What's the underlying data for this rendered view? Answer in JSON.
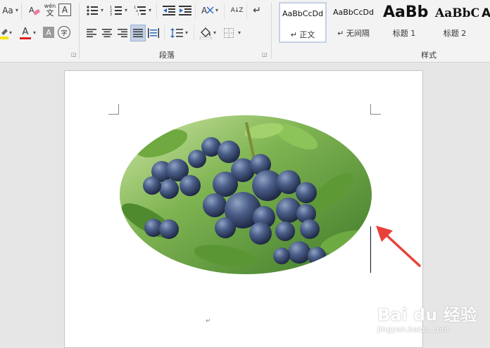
{
  "ribbon": {
    "font_group": {
      "change_case_label": "Aa",
      "phonetic_guide_top": "wén",
      "phonetic_guide_bottom": "文",
      "char_border_label": "A",
      "font_color_label": "A",
      "char_shading_label": "A",
      "enclose_char_label": "字",
      "font_color_bar": "#e02020",
      "highlight_bar": "#f5e500"
    },
    "paragraph_group": {
      "label": "段落",
      "sort_label": "A↓Z",
      "show_marks_label": "↵"
    },
    "styles_group": {
      "label": "样式",
      "items": [
        {
          "sample": "AaBbCcDd",
          "name": "↵ 正文",
          "selected": true
        },
        {
          "sample": "AaBbCcDd",
          "name": "↵ 无间隔",
          "selected": false
        },
        {
          "sample": "AaBb",
          "name": "标题 1",
          "selected": false
        },
        {
          "sample": "AaBbC",
          "name": "标题 2",
          "selected": false
        },
        {
          "sample": "A",
          "name": "",
          "selected": false
        }
      ]
    }
  },
  "document": {
    "paragraph_mark": "↵",
    "image_name": "blueberries"
  },
  "watermark": {
    "text": "Bai du 经验",
    "sub": "jingyan.baidu.com"
  },
  "annotation": {
    "arrow_color": "#e8413a"
  }
}
